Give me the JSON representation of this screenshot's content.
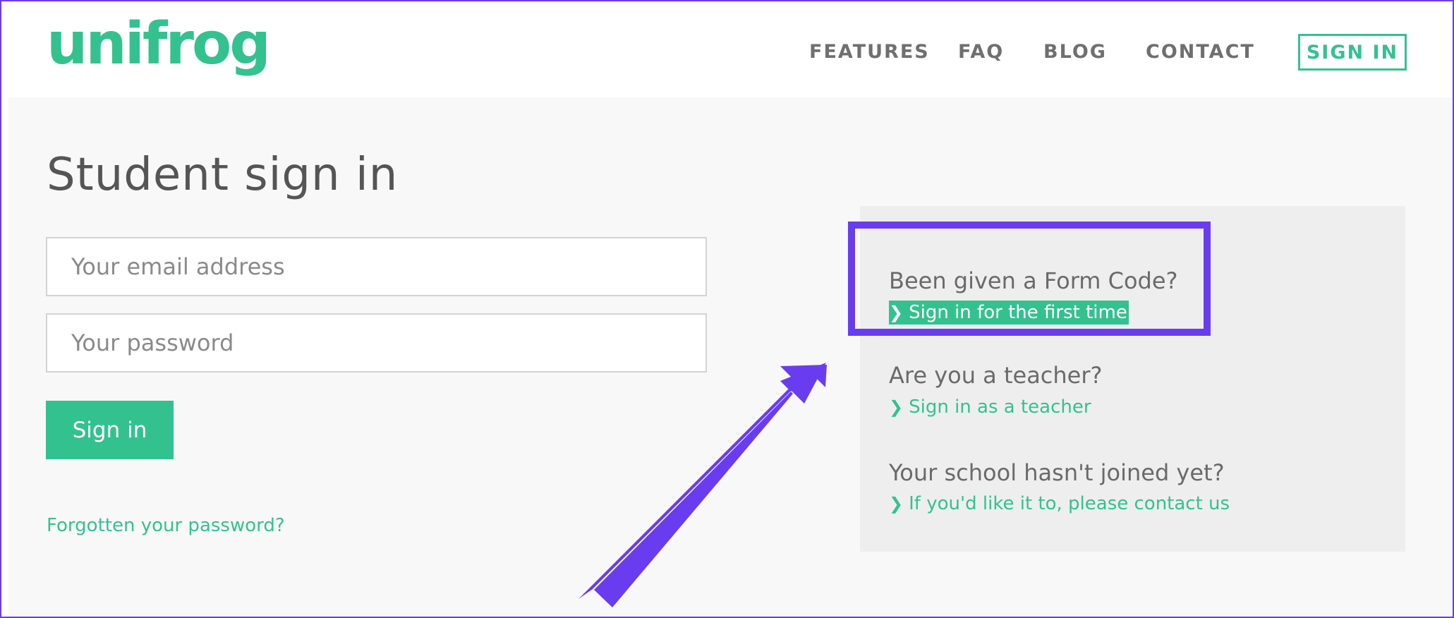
{
  "header": {
    "logo": "unifrog",
    "nav": {
      "features": "FEATURES",
      "faq": "FAQ",
      "blog": "BLOG",
      "contact": "CONTACT",
      "sign_in": "SIGN IN"
    }
  },
  "main": {
    "title": "Student sign in",
    "email_placeholder": "Your email address",
    "password_placeholder": "Your password",
    "sign_in_button": "Sign in",
    "forgot_password": "Forgotten your password?"
  },
  "panel": {
    "form_code_question": "Been given a Form Code?",
    "form_code_link": "Sign in for the first time",
    "teacher_question": "Are you a teacher?",
    "teacher_link": "Sign in as a teacher",
    "school_question": "Your school hasn't joined yet?",
    "school_link": "If you'd like it to, please contact us"
  },
  "colors": {
    "brand_green": "#33c28f",
    "annotation_purple": "#6a3cf0",
    "panel_bg": "#eeeeee",
    "page_bg": "#f8f8f8"
  },
  "icons": {
    "link_chevron": "chevron-right-icon",
    "annotation_arrow": "arrow-up-right-icon"
  }
}
